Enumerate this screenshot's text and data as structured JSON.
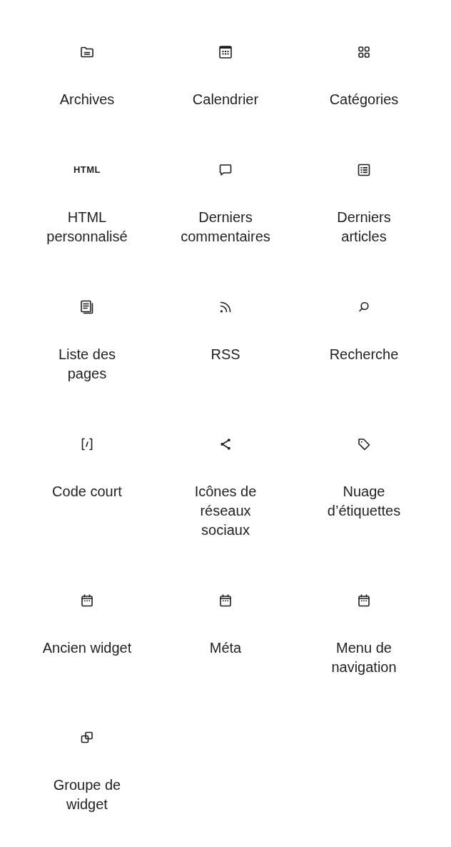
{
  "widgets": [
    {
      "label": "Archives"
    },
    {
      "label": "Calendrier"
    },
    {
      "label": "Catégories"
    },
    {
      "label": "HTML\npersonnalisé",
      "icon_text": "HTML"
    },
    {
      "label": "Derniers\ncommentaires"
    },
    {
      "label": "Derniers\narticles"
    },
    {
      "label": "Liste des\npages"
    },
    {
      "label": "RSS"
    },
    {
      "label": "Recherche"
    },
    {
      "label": "Code court"
    },
    {
      "label": "Icônes de\nréseaux\nsociaux"
    },
    {
      "label": "Nuage\nd’étiquettes"
    },
    {
      "label": "Ancien widget"
    },
    {
      "label": "Méta"
    },
    {
      "label": "Menu de\nnavigation"
    },
    {
      "label": "Groupe de\nwidget"
    }
  ]
}
